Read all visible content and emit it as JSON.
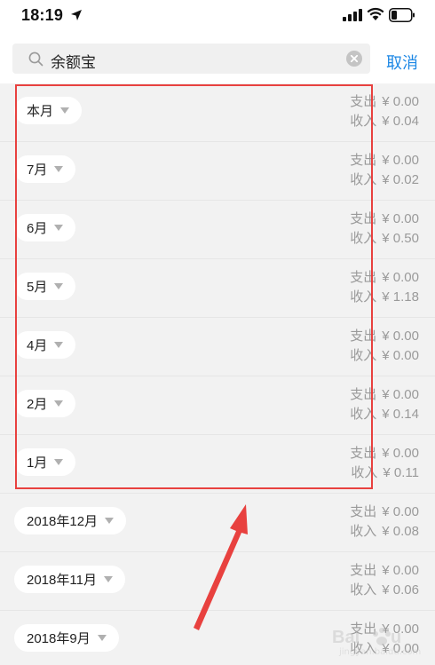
{
  "status_bar": {
    "time": "18:19"
  },
  "search": {
    "query": "余额宝",
    "cancel_label": "取消"
  },
  "labels": {
    "expense": "支出",
    "income": "收入"
  },
  "rows": [
    {
      "month": "本月",
      "expense": "¥ 0.00",
      "income": "¥ 0.04"
    },
    {
      "month": "7月",
      "expense": "¥ 0.00",
      "income": "¥ 0.02"
    },
    {
      "month": "6月",
      "expense": "¥ 0.00",
      "income": "¥ 0.50"
    },
    {
      "month": "5月",
      "expense": "¥ 0.00",
      "income": "¥ 1.18"
    },
    {
      "month": "4月",
      "expense": "¥ 0.00",
      "income": "¥ 0.00"
    },
    {
      "month": "2月",
      "expense": "¥ 0.00",
      "income": "¥ 0.14"
    },
    {
      "month": "1月",
      "expense": "¥ 0.00",
      "income": "¥ 0.11"
    },
    {
      "month": "2018年12月",
      "expense": "¥ 0.00",
      "income": "¥ 0.08"
    },
    {
      "month": "2018年11月",
      "expense": "¥ 0.00",
      "income": "¥ 0.06"
    },
    {
      "month": "2018年9月",
      "expense": "¥ 0.00",
      "income": "¥ 0.00"
    }
  ],
  "colors": {
    "accent": "#1e88e5",
    "highlight": "#e8413f",
    "muted_text": "#9a9a9a"
  },
  "watermark": "Baidu 经验"
}
